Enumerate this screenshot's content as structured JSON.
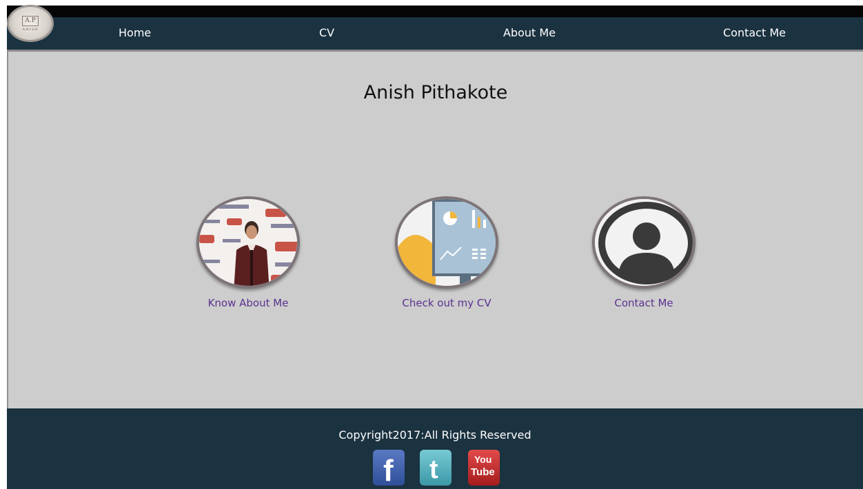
{
  "nav": {
    "logo_monogram": "A.P",
    "logo_name": "ANISH",
    "links": [
      "Home",
      "CV",
      "About Me",
      "Contact Me"
    ]
  },
  "main": {
    "title": "Anish Pithakote",
    "cards": [
      {
        "label": "Know About Me"
      },
      {
        "label": "Check out my CV"
      },
      {
        "label": "Contact Me"
      }
    ]
  },
  "footer": {
    "copyright": "Copyright2017:All Rights Reserved",
    "social": [
      {
        "name": "facebook",
        "glyph": "f"
      },
      {
        "name": "twitter",
        "glyph": "t"
      },
      {
        "name": "youtube",
        "glyph_top": "You",
        "glyph_bottom": "Tube"
      }
    ]
  },
  "colors": {
    "nav_bg": "#1b3240",
    "main_bg": "#cdcdcd",
    "link_purple": "#5b3190"
  }
}
